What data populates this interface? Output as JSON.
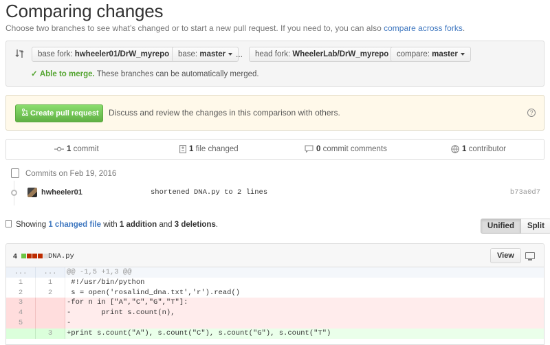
{
  "page": {
    "title": "Comparing changes",
    "subtitle_text": "Choose two branches to see what’s changed or to start a new pull request. If you need to, you can also",
    "subtitle_link": "compare across forks",
    "subtitle_end": "."
  },
  "range": {
    "base_fork_label": "base fork:",
    "base_fork_value": "hwheeler01/DrW_myrepo",
    "base_label": "base:",
    "base_value": "master",
    "dots": "...",
    "head_fork_label": "head fork:",
    "head_fork_value": "WheelerLab/DrW_myrepo",
    "compare_label": "compare:",
    "compare_value": "master",
    "merge_status": "Able to merge.",
    "merge_text": "These branches can be automatically merged."
  },
  "pull_request": {
    "button_label": "Create pull request",
    "description": "Discuss and review the changes in this comparison with others.",
    "help_glyph": "?"
  },
  "stats": {
    "commits_count": "1",
    "commits_label": "commit",
    "files_count": "1",
    "files_label": "file changed",
    "comments_count": "0",
    "comments_label": "commit comments",
    "contributors_count": "1",
    "contributors_label": "contributor"
  },
  "commits": {
    "date_label": "Commits on Feb 19, 2016",
    "items": [
      {
        "author": "hwheeler01",
        "message": "shortened DNA.py to 2 lines",
        "sha": "b73a0d7"
      }
    ]
  },
  "summary": {
    "showing": "Showing",
    "changed_files": "1 changed file",
    "with": "with",
    "additions": "1 addition",
    "and": "and",
    "deletions": "3 deletions",
    "end": "."
  },
  "view_toggle": {
    "unified": "Unified",
    "split": "Split",
    "selected": "Unified"
  },
  "file": {
    "change_count": "4",
    "name": "DNA.py",
    "view_button": "View",
    "diffstat": [
      "add",
      "del",
      "del",
      "del",
      "neutral"
    ],
    "colors": {
      "add": "#6cc644",
      "del": "#bd2c00",
      "neutral": "#dddddd"
    },
    "lines": [
      {
        "type": "hunk",
        "old": "...",
        "new": "...",
        "text": "@@ -1,5 +1,3 @@"
      },
      {
        "type": "ctx",
        "old": "1",
        "new": "1",
        "text": " #!/usr/bin/python"
      },
      {
        "type": "ctx",
        "old": "2",
        "new": "2",
        "text": " s = open('rosalind_dna.txt','r').read()"
      },
      {
        "type": "del",
        "old": "3",
        "new": "",
        "text": "-for n in [\"A\",\"C\",\"G\",\"T\"]:"
      },
      {
        "type": "del",
        "old": "4",
        "new": "",
        "text": "-       print s.count(n),"
      },
      {
        "type": "del",
        "old": "5",
        "new": "",
        "text": "-"
      },
      {
        "type": "add",
        "old": "",
        "new": "3",
        "text": "+print s.count(\"A\"), s.count(\"C\"), s.count(\"G\"), s.count(\"T\")"
      }
    ]
  }
}
